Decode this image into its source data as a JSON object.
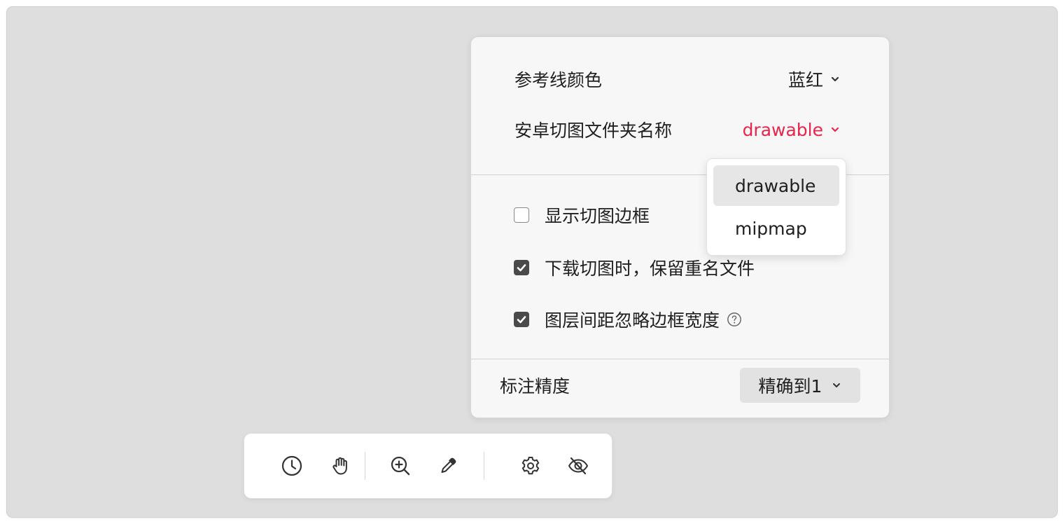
{
  "settings": {
    "guide_color": {
      "label": "参考线颜色",
      "value": "蓝红"
    },
    "android_folder": {
      "label": "安卓切图文件夹名称",
      "value": "drawable",
      "accent": "#e8254d"
    },
    "options": [
      {
        "label": "显示切图边框",
        "checked": false
      },
      {
        "label": "下载切图时，保留重名文件",
        "checked": true
      },
      {
        "label": "图层间距忽略边框宽度",
        "checked": true,
        "help": true
      }
    ],
    "precision": {
      "label": "标注精度",
      "value": "精确到1"
    }
  },
  "folder_dropdown": {
    "options": [
      "drawable",
      "mipmap"
    ],
    "selected": "drawable"
  },
  "toolbar": {
    "tools": [
      "history-icon",
      "hand-icon",
      "zoom-in-icon",
      "eyedropper-icon",
      "gear-icon",
      "eye-off-icon"
    ]
  }
}
